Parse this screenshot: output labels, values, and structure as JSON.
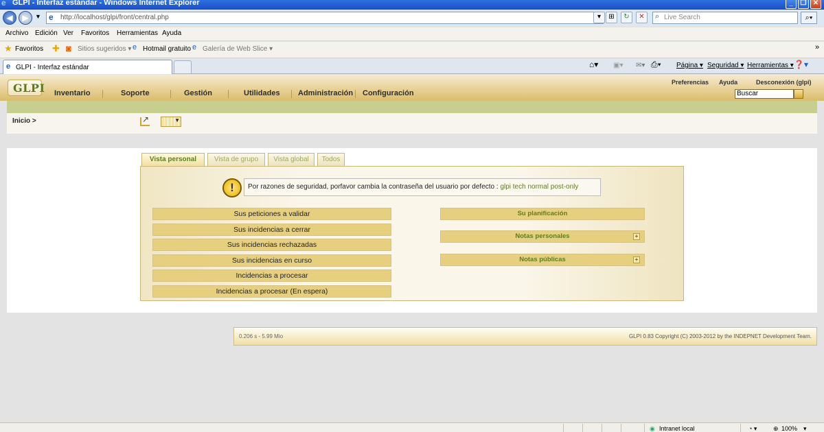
{
  "window": {
    "title": "GLPI - Interfaz estándar - Windows Internet Explorer",
    "minimize": "_",
    "restore": "❐",
    "close": "✕"
  },
  "address": {
    "back_icon": "back-arrow-icon",
    "forward_icon": "forward-arrow-icon",
    "url": "http://localhost/glpi/front/central.php",
    "search_placeholder": "Live Search"
  },
  "menu": [
    "Archivo",
    "Edición",
    "Ver",
    "Favoritos",
    "Herramientas",
    "Ayuda"
  ],
  "favorites": {
    "favorites_label": "Favoritos",
    "items": [
      "Sitios sugeridos ▾",
      "Hotmail gratuito",
      "Galería de Web Slice ▾"
    ]
  },
  "browser_tab": {
    "label": "GLPI - Interfaz estándar"
  },
  "command_bar": [
    "Página ▾",
    "Seguridad ▾",
    "Herramientas ▾"
  ],
  "glpi": {
    "logo": "GLPI",
    "nav": [
      "Inventario",
      "Soporte",
      "Gestión",
      "Utilidades",
      "Administración",
      "Configuración"
    ],
    "top_links": [
      "Preferencias",
      "Ayuda",
      "Desconexión (glpi)"
    ],
    "search_value": "Buscar",
    "breadcrumb": "Inicio >",
    "tabs": [
      "Vista personal",
      "Vista de grupo",
      "Vista global",
      "Todos"
    ],
    "warning": {
      "text": "Por razones de seguridad, porfavor cambia la contraseña del usuario por defecto : ",
      "users": "glpi tech normal post-only"
    },
    "left_buttons": [
      "Sus peticiones a validar",
      "Sus incidencias a cerrar",
      "Sus incidencias rechazadas",
      "Sus incidencias en curso",
      "Incidencias a procesar",
      "Incidencias a procesar (En espera)"
    ],
    "right_buttons": [
      "Su planificación",
      "Notas personales",
      "Notas públicas"
    ],
    "footer_left": "0.206 s - 5.99 Mio",
    "footer_right": "GLPI 0.83 Copyright (C) 2003-2012 by the INDEPNET Development Team."
  },
  "status": {
    "zone": "Intranet local",
    "zoom": "100%"
  }
}
